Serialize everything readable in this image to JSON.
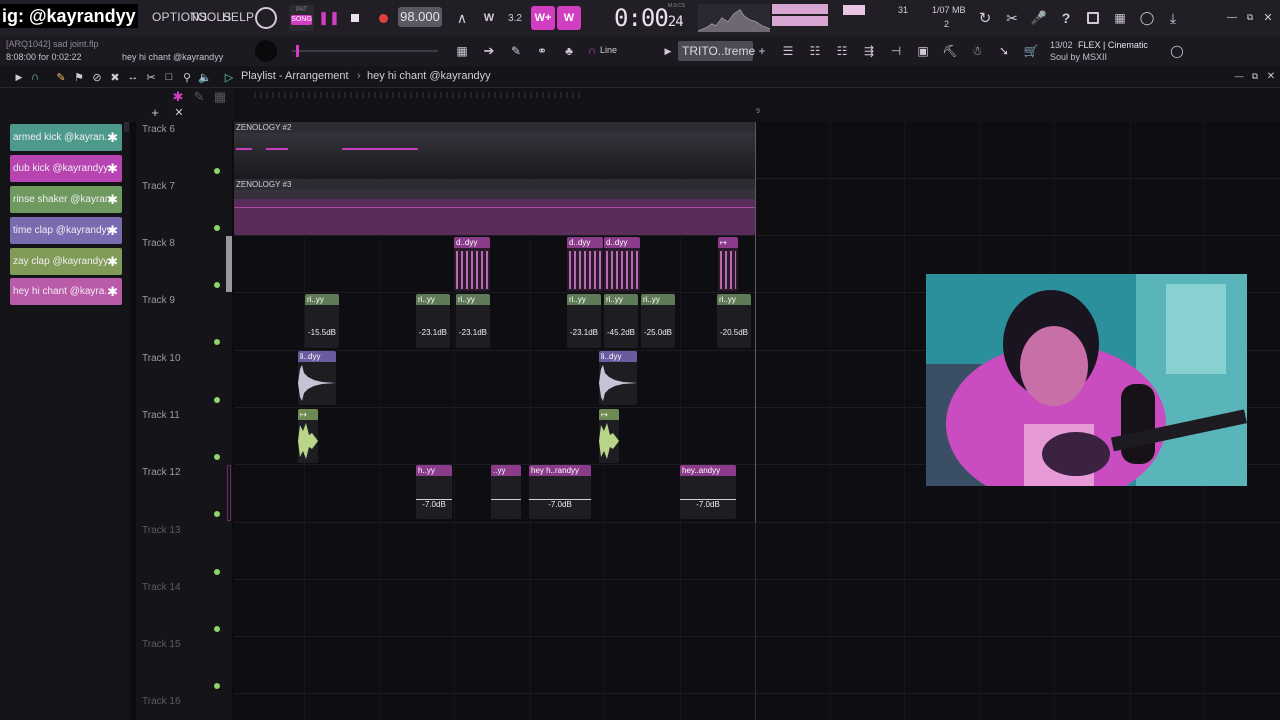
{
  "overlay_handle": "ig: @kayrandyy",
  "menu": {
    "options": "OPTIONS",
    "tools": "TOOLS",
    "help": "HELP"
  },
  "transport": {
    "pat": "PAT",
    "song": "SONG",
    "tempo": "98.000",
    "time": "0:00",
    "time_small": "24",
    "time_unit": "M:S:CS"
  },
  "meters": {
    "cpu": "31",
    "mem": "1/07 MB",
    "poly": "2"
  },
  "project": {
    "file": "[ARQ1042] sad joint.flp",
    "duration": "8:08:00 for 0:02:22",
    "hint": "hey hi chant @kayrandyy"
  },
  "snap": "Line",
  "preset": "TRITO..treme",
  "news": {
    "count": "13/02",
    "title": "FLEX | Cinematic",
    "subtitle": "Soul by MSXII"
  },
  "breadcrumb": {
    "a": "Playlist - Arrangement",
    "b": "hey hi chant @kayrandyy"
  },
  "ruler_mark": "9",
  "channels": [
    {
      "label": "armed kick @kayran..",
      "color": "#4d9a8c"
    },
    {
      "label": "dub kick @kayrandyy",
      "color": "#b744b0"
    },
    {
      "label": "rinse shaker @kayran..",
      "color": "#6e9a60"
    },
    {
      "label": "time clap @kayrandyy",
      "color": "#7a6bb0"
    },
    {
      "label": "zay clap @kayrandyy",
      "color": "#7f9b57"
    },
    {
      "label": "hey hi chant @kayra..",
      "color": "#b95ba8"
    }
  ],
  "tracks": [
    "Track 6",
    "Track 7",
    "Track 8",
    "Track 9",
    "Track 10",
    "Track 11",
    "Track 12",
    "Track 13",
    "Track 14",
    "Track 15",
    "Track 16"
  ],
  "automation": {
    "zen2": "ZENOLOGY #2",
    "zen3": "ZENOLOGY #3"
  },
  "clips": {
    "t8": "d..dyy",
    "t9": "ri..yy",
    "t10": "li..dyy",
    "t12a": "h..yy",
    "t12b": "..yy",
    "t12c": "hey h..randyy",
    "t12d": "hey..andyy"
  },
  "vols": {
    "t9": [
      "-15.5dB",
      "-23.1dB",
      "-23.1dB",
      "-23.1dB",
      "-45.2dB",
      "-25.0dB",
      "-20.5dB"
    ],
    "t12": [
      "-7.0dB",
      "-7.0dB",
      "-7.0dB"
    ]
  }
}
